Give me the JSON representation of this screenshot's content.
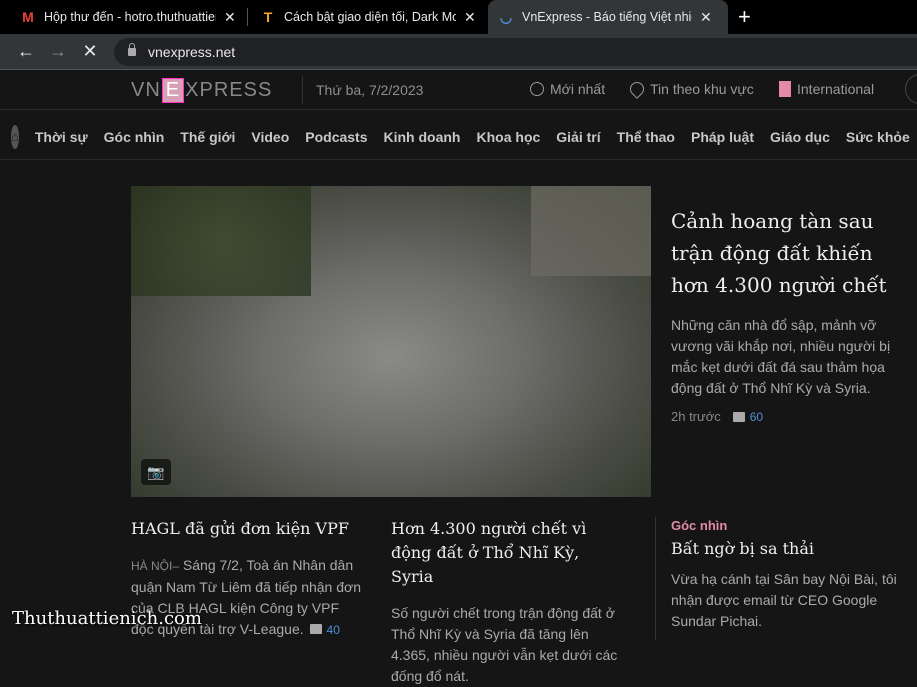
{
  "tabs": [
    {
      "title": "Hộp thư đến - hotro.thuthuattienich",
      "icon": "gmail-icon"
    },
    {
      "title": "Cách bật giao diện tối, Dark Mode",
      "icon": "t-logo-icon"
    },
    {
      "title": "VnExpress - Báo tiếng Việt nhiều người xem nhất",
      "icon": "loading-icon",
      "active": true
    }
  ],
  "url": "vnexpress.net",
  "header": {
    "logo": "VNEXPRESS",
    "date": "Thứ ba, 7/2/2023",
    "links": [
      "Mới nhất",
      "Tin theo khu vực",
      "International"
    ]
  },
  "nav": [
    "Thời sự",
    "Góc nhìn",
    "Thế giới",
    "Video",
    "Podcasts",
    "Kinh doanh",
    "Khoa học",
    "Giải trí",
    "Thể thao",
    "Pháp luật",
    "Giáo dục",
    "Sức khỏe"
  ],
  "featured": {
    "title": "Cảnh hoang tàn sau trận động đất khiến hơn 4.300 người chết",
    "summary": "Những căn nhà đổ sập, mảnh vỡ vương vãi khắp nơi, nhiều người bị mắc kẹt dưới đất đá sau thảm họa động đất ở Thổ Nhĩ Kỳ và Syria.",
    "time": "2h trước",
    "comments": "60"
  },
  "articles": [
    {
      "title": "HAGL đã gửi đơn kiện VPF",
      "location": "HÀ NỘI–",
      "summary": " Sáng 7/2, Toà án Nhân dân quận Nam Từ Liêm đã tiếp nhận đơn của CLB HAGL kiện Công ty VPF độc quyền tài trợ V-League.",
      "comments": "40"
    },
    {
      "title": "Hơn 4.300 người chết vì động đất ở Thổ Nhĩ Kỳ, Syria",
      "summary": "Số người chết trong trận động đất ở Thổ Nhĩ Kỳ và Syria đã tăng lên 4.365, nhiều người vẫn kẹt dưới các đống đổ nát."
    },
    {
      "category": "Góc nhìn",
      "title": "Bất ngờ bị sa thải",
      "summary": "Vừa hạ cánh tại Sân bay Nội Bài, tôi nhận được email từ CEO Google Sundar Pichai."
    }
  ],
  "watermark": "Thuthuattienich.com"
}
